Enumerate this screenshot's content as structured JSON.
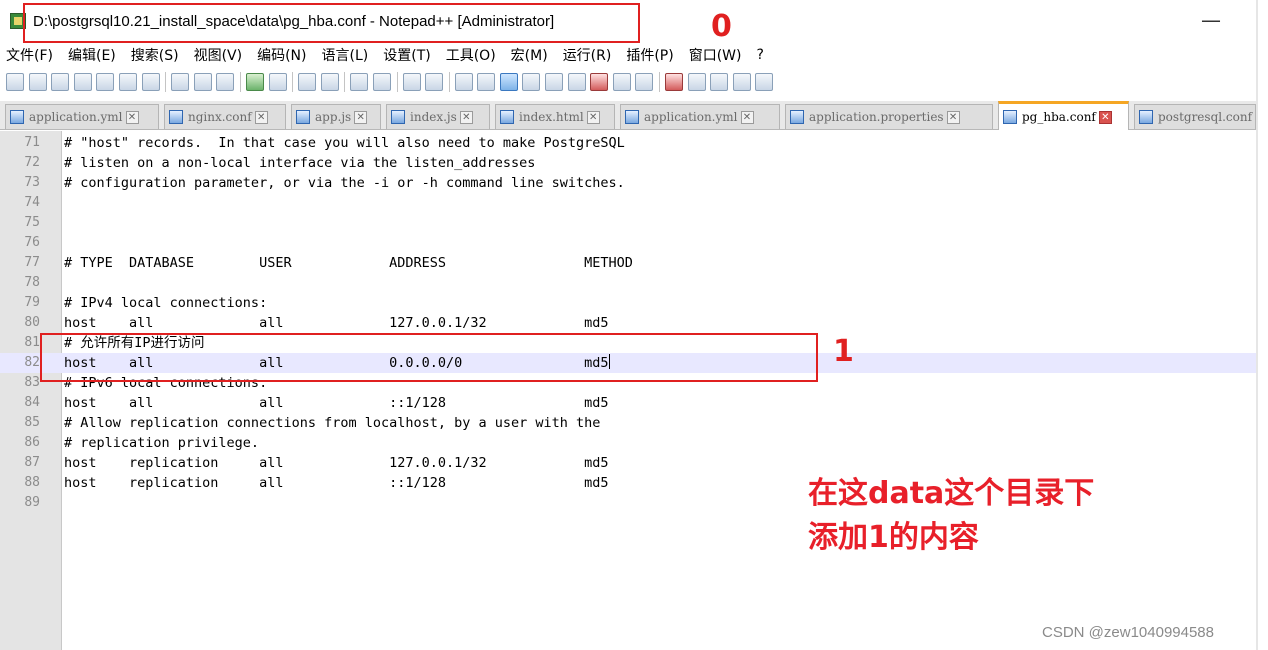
{
  "window": {
    "title": "D:\\postgrsql10.21_install_space\\data\\pg_hba.conf - Notepad++ [Administrator]",
    "minimize_glyph": "—"
  },
  "menu": [
    "文件(F)",
    "编辑(E)",
    "搜索(S)",
    "视图(V)",
    "编码(N)",
    "语言(L)",
    "设置(T)",
    "工具(O)",
    "宏(M)",
    "运行(R)",
    "插件(P)",
    "窗口(W)",
    "?"
  ],
  "tabs": [
    {
      "label": "application.yml",
      "active": false
    },
    {
      "label": "nginx.conf",
      "active": false
    },
    {
      "label": "app.js",
      "active": false
    },
    {
      "label": "index.js",
      "active": false
    },
    {
      "label": "index.html",
      "active": false
    },
    {
      "label": "application.yml",
      "active": false
    },
    {
      "label": "application.properties",
      "active": false
    },
    {
      "label": "pg_hba.conf",
      "active": true
    },
    {
      "label": "postgresql.conf",
      "active": false
    }
  ],
  "tab_close_glyph": "✕",
  "editor": {
    "lines": [
      {
        "n": "71",
        "text": "# \"host\" records.  In that case you will also need to make PostgreSQL"
      },
      {
        "n": "72",
        "text": "# listen on a non-local interface via the listen_addresses"
      },
      {
        "n": "73",
        "text": "# configuration parameter, or via the -i or -h command line switches."
      },
      {
        "n": "74",
        "text": ""
      },
      {
        "n": "75",
        "text": ""
      },
      {
        "n": "76",
        "text": ""
      },
      {
        "n": "77",
        "text": "# TYPE  DATABASE        USER            ADDRESS                 METHOD"
      },
      {
        "n": "78",
        "text": ""
      },
      {
        "n": "79",
        "text": "# IPv4 local connections:"
      },
      {
        "n": "80",
        "text": "host    all             all             127.0.0.1/32            md5"
      },
      {
        "n": "81",
        "text": "# 允许所有IP进行访问"
      },
      {
        "n": "82",
        "text": "host    all             all             0.0.0.0/0               md5",
        "current": true
      },
      {
        "n": "83",
        "text": "# IPv6 local connections:"
      },
      {
        "n": "84",
        "text": "host    all             all             ::1/128                 md5"
      },
      {
        "n": "85",
        "text": "# Allow replication connections from localhost, by a user with the"
      },
      {
        "n": "86",
        "text": "# replication privilege."
      },
      {
        "n": "87",
        "text": "host    replication     all             127.0.0.1/32            md5"
      },
      {
        "n": "88",
        "text": "host    replication     all             ::1/128                 md5"
      },
      {
        "n": "89",
        "text": ""
      }
    ]
  },
  "annotations": {
    "label_0": "0",
    "label_1": "1",
    "note_line1": "在这data这个目录下",
    "note_line2": "添加1的内容",
    "color": "#e02020"
  },
  "watermark": "CSDN @zew1040994588"
}
